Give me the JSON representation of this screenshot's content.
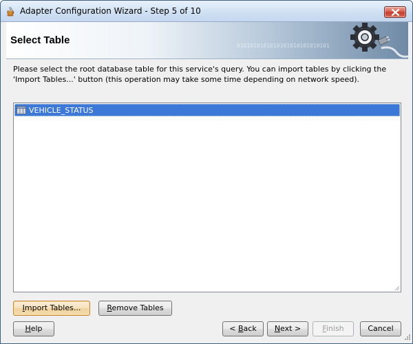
{
  "window": {
    "title": "Adapter Configuration Wizard - Step 5 of 10",
    "icon": "coffee-cup-icon",
    "close_icon": "close-icon"
  },
  "banner": {
    "title": "Select Table",
    "binary_text": "0101010101010101010101010101",
    "graphic": "gear-plug-icon"
  },
  "description": "Please select the root database table for this service's query.  You can import tables by clicking the 'Import Tables...' button (this operation may take some time depending on network speed).",
  "tables": {
    "items": [
      {
        "label": "VEHICLE_STATUS",
        "icon": "database-table-icon",
        "selected": true
      }
    ]
  },
  "actions": {
    "import_label_ul": "I",
    "import_label_rest": "mport Tables...",
    "remove_label_ul": "R",
    "remove_label_rest": "emove Tables"
  },
  "footer": {
    "help_ul": "H",
    "help_rest": "elp",
    "back_pre": "< ",
    "back_ul": "B",
    "back_rest": "ack",
    "next_ul": "N",
    "next_rest": "ext >",
    "finish_ul": "F",
    "finish_rest": "inish",
    "cancel_label": "Cancel"
  },
  "colors": {
    "selection": "#3b78d8",
    "focus_border": "#c0863c"
  }
}
